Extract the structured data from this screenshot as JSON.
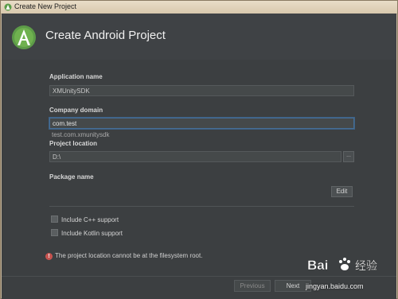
{
  "window": {
    "title": "Create New Project"
  },
  "header": {
    "title": "Create Android Project"
  },
  "form": {
    "application_name": {
      "label": "Application name",
      "value": "XMUnitySDK"
    },
    "company_domain": {
      "label": "Company domain",
      "value": "com.test"
    },
    "project_location": {
      "label": "Project location",
      "value": "D:\\",
      "browse_label": "..."
    },
    "package_name": {
      "label": "Package name",
      "value": "test.com.xmunitysdk",
      "edit_label": "Edit"
    },
    "include_cpp": {
      "label": "Include C++ support",
      "checked": false
    },
    "include_kotlin": {
      "label": "Include Kotlin support",
      "checked": false
    }
  },
  "error": {
    "icon": "error-icon",
    "text": "The project location cannot be at the filesystem root."
  },
  "footer": {
    "previous_label": "Previous",
    "next_label": "Next"
  },
  "watermark": {
    "text": "jingyan.baidu.com",
    "logo": "Bai 经验"
  },
  "colors": {
    "header_bg": "#3f4245",
    "content_bg": "#3c3f41",
    "focus_border": "#466d94",
    "error": "#c75450",
    "android_green": "#a4c639"
  }
}
